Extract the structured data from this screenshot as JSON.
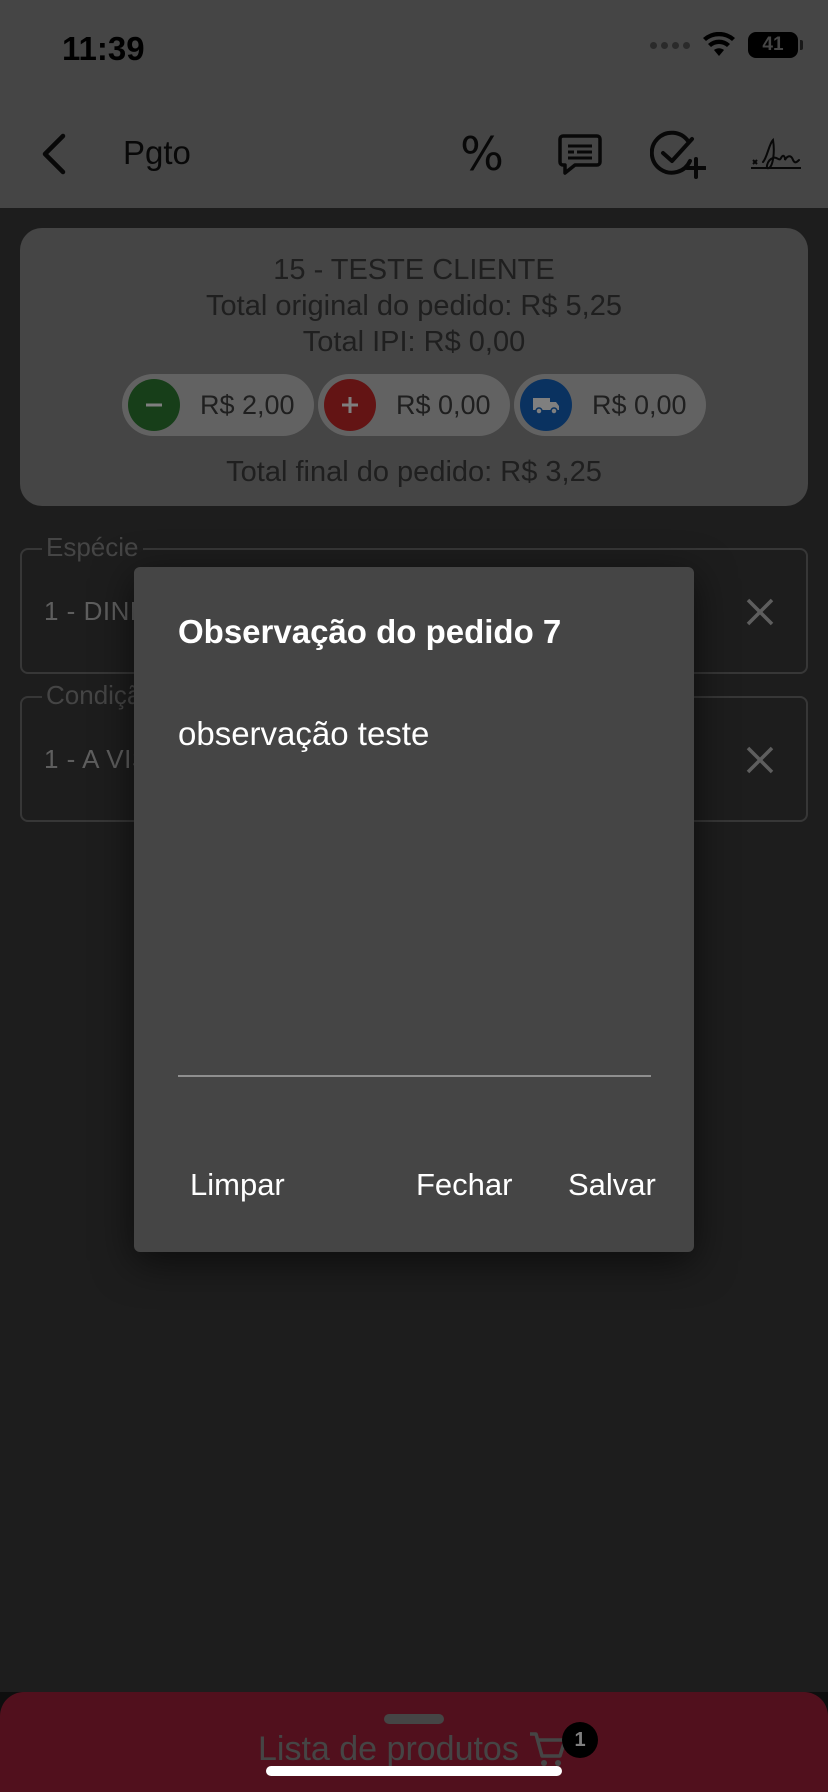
{
  "status_bar": {
    "time": "11:39",
    "battery": "41"
  },
  "app_bar": {
    "title": "Pgto",
    "actions": [
      "percent-icon",
      "message-icon",
      "check-plus-icon",
      "signature-icon"
    ],
    "percent_symbol": "%"
  },
  "summary": {
    "client": "15 - TESTE CLIENTE",
    "original_total": "Total original do pedido: R$ 5,25",
    "ipi_total": "Total IPI: R$ 0,00",
    "discount": {
      "value": "R$ 2,00",
      "color": "#2e7d32",
      "icon": "minus-icon"
    },
    "surcharge": {
      "value": "R$ 0,00",
      "color": "#c62828",
      "icon": "plus-icon"
    },
    "freight": {
      "value": "R$ 0,00",
      "color": "#1565c0",
      "icon": "truck-icon"
    },
    "final_total": "Total final do pedido: R$ 3,25"
  },
  "fields": {
    "especie": {
      "label": "Espécie",
      "value": "1 - DINHEIRO"
    },
    "condicao": {
      "label": "Condição",
      "value": "1 - A VISTA"
    }
  },
  "dialog": {
    "title": "Observação do pedido 7",
    "text": "observação teste",
    "buttons": {
      "clear": "Limpar",
      "close": "Fechar",
      "save": "Salvar"
    }
  },
  "bottom_sheet": {
    "label": "Lista de produtos",
    "cart_count": "1"
  }
}
